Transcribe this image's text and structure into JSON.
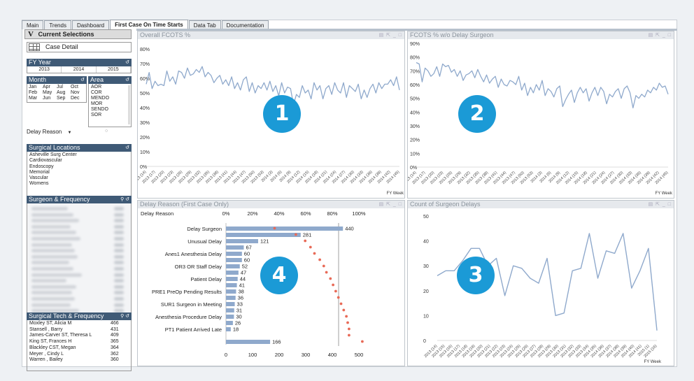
{
  "tabs": [
    {
      "label": "Main",
      "active": false
    },
    {
      "label": "Trends",
      "active": false
    },
    {
      "label": "Dashboard",
      "active": false
    },
    {
      "label": "First Case On Time Starts",
      "active": true
    },
    {
      "label": "Data Tab",
      "active": false
    },
    {
      "label": "Documentation",
      "active": false
    }
  ],
  "left": {
    "current_selections": "Current Selections",
    "current_selections_icon": "V",
    "case_detail": "Case Detail",
    "fy_title": "FY Year",
    "fy_years": [
      "2013",
      "2014",
      "2015"
    ],
    "month_title": "Month",
    "months": [
      "Jan",
      "Apr",
      "Jul",
      "Oct",
      "Feb",
      "May",
      "Aug",
      "Nov",
      "Mar",
      "Jun",
      "Sep",
      "Dec"
    ],
    "area_title": "Area",
    "areas": [
      "AOR",
      "COR",
      "MENDO",
      "MOR",
      "SENDO",
      "SOR"
    ],
    "delay_reason_label": "Delay Reason",
    "surgical_locations_title": "Surgical Locations",
    "surgical_locations": [
      "Asheville Surg Center",
      "Cardiovascular",
      "Endoscopy",
      "Memorial",
      "Vascular",
      "Womens"
    ],
    "surgeon_freq_title": "Surgeon & Frequency",
    "tech_freq_title": "Surgical Tech & Frequency",
    "tech_freq": [
      {
        "name": "Moxley ST, Alicia M",
        "value": "466"
      },
      {
        "name": "Stansell , Barry",
        "value": "431"
      },
      {
        "name": "James-Carver ST, Theresa L",
        "value": "409"
      },
      {
        "name": "King ST, Frances H",
        "value": "365"
      },
      {
        "name": "Blackley CST, Megan",
        "value": "364"
      },
      {
        "name": "Meyer , Cindy L",
        "value": "362"
      },
      {
        "name": "Warren , Bailey",
        "value": "360"
      }
    ]
  },
  "panels": {
    "p1_title": "Overall FCOTS %",
    "p2_title": "FCOTS % w/o Delay Surgeon",
    "p3_title": "Count of Surgeon Delays",
    "p4_title": "Delay Reason (First Case Only)",
    "p4_axis_label": "Delay Reason",
    "fy_week": "FY Week",
    "badges": [
      "1",
      "2",
      "3",
      "4"
    ]
  },
  "chart_data": [
    {
      "type": "line",
      "title": "Overall FCOTS %",
      "xlabel": "FY Week",
      "ylabel": "",
      "ylim": [
        0,
        80
      ],
      "yticks": [
        "0%",
        "10%",
        "20%",
        "30%",
        "40%",
        "50%",
        "60%",
        "70%",
        "80%"
      ],
      "xticks": [
        "2013 (14)",
        "2013 (17)",
        "2013 (20)",
        "2013 (23)",
        "2013 (26)",
        "2013 (29)",
        "2013 (32)",
        "2013 (35)",
        "2013 (38)",
        "2013 (41)",
        "2013 (44)",
        "2013 (47)",
        "2013 (50)",
        "2013 (53)",
        "2014 (3)",
        "2014 (6)",
        "2014 (9)",
        "2014 (12)",
        "2014 (15)",
        "2014 (18)",
        "2014 (21)",
        "2014 (24)",
        "2014 (27)",
        "2014 (30)",
        "2014 (33)",
        "2014 (36)",
        "2014 (39)",
        "2014 (42)",
        "2014 (45)"
      ],
      "series": [
        {
          "values": [
            56,
            64,
            53,
            58,
            55,
            56,
            55,
            65,
            58,
            61,
            56,
            65,
            64,
            60,
            67,
            62,
            63,
            66,
            64,
            68,
            61,
            64,
            62,
            57,
            60,
            62,
            56,
            59,
            55,
            61,
            53,
            57,
            52,
            59,
            61,
            51,
            57,
            50,
            55,
            53,
            57,
            52,
            58,
            51,
            55,
            48,
            57,
            50,
            54,
            53,
            42,
            49,
            47,
            55,
            50,
            52,
            46,
            57,
            52,
            55,
            46,
            53,
            55,
            49,
            57,
            52,
            50,
            57,
            47,
            55,
            53,
            51,
            56,
            46,
            52,
            47,
            53,
            56,
            50,
            57,
            53,
            56,
            56,
            59,
            55,
            61,
            52
          ]
        }
      ]
    },
    {
      "type": "line",
      "title": "FCOTS % w/o Delay Surgeon",
      "xlabel": "FY Week",
      "ylabel": "",
      "ylim": [
        0,
        90
      ],
      "yticks": [
        "0%",
        "10%",
        "20%",
        "30%",
        "40%",
        "50%",
        "60%",
        "70%",
        "80%",
        "90%"
      ],
      "xticks": [
        "2013 (14)",
        "2013 (17)",
        "2013 (20)",
        "2013 (23)",
        "2013 (26)",
        "2013 (29)",
        "2013 (32)",
        "2013 (35)",
        "2013 (38)",
        "2013 (41)",
        "2013 (44)",
        "2013 (47)",
        "2013 (50)",
        "2013 (53)",
        "2014 (3)",
        "2014 (6)",
        "2014 (9)",
        "2014 (12)",
        "2014 (15)",
        "2014 (18)",
        "2014 (21)",
        "2014 (24)",
        "2014 (27)",
        "2014 (30)",
        "2014 (33)",
        "2014 (36)",
        "2014 (39)",
        "2014 (42)",
        "2014 (45)"
      ],
      "series": [
        {
          "values": [
            76,
            75,
            62,
            72,
            70,
            66,
            68,
            73,
            66,
            75,
            73,
            74,
            69,
            71,
            66,
            70,
            63,
            67,
            68,
            70,
            65,
            71,
            66,
            62,
            67,
            61,
            64,
            66,
            58,
            64,
            60,
            59,
            63,
            62,
            60,
            66,
            56,
            61,
            52,
            58,
            54,
            60,
            56,
            63,
            52,
            57,
            55,
            51,
            57,
            59,
            44,
            49,
            53,
            56,
            47,
            54,
            58,
            54,
            57,
            48,
            54,
            58,
            52,
            58,
            55,
            46,
            53,
            51,
            55,
            57,
            50,
            57,
            59,
            54,
            43,
            52,
            50,
            53,
            51,
            56,
            54,
            58,
            56,
            61,
            58,
            59,
            53
          ]
        }
      ]
    },
    {
      "type": "line",
      "title": "Count of Surgeon Delays",
      "xlabel": "FY Week",
      "ylabel": "",
      "ylim": [
        0,
        50
      ],
      "yticks": [
        "0",
        "10",
        "20",
        "30",
        "40",
        "50"
      ],
      "xticks": [
        "2013 (14)",
        "2013 (15)",
        "2013 (16)",
        "2013 (17)",
        "2013 (18)",
        "2013 (19)",
        "2013 (20)",
        "2013 (21)",
        "2013 (22)",
        "2013 (23)",
        "2013 (24)",
        "2013 (25)",
        "2013 (26)",
        "2013 (27)",
        "2013 (28)",
        "2013 (29)",
        "2013 (30)",
        "2013 (31)",
        "2013 (32)",
        "2013 (33)",
        "2013 (34)",
        "2014 (35)",
        "2014 (36)",
        "2014 (37)",
        "2014 (38)",
        "2014 (39)",
        "2014 (40)",
        "2014 (41)",
        "2015 (1)",
        "2015 (16)"
      ],
      "series": [
        {
          "values": [
            26,
            28,
            28,
            32,
            37,
            37,
            30,
            33,
            18,
            30,
            29,
            25,
            23,
            33,
            10,
            11,
            28,
            29,
            43,
            25,
            36,
            35,
            43,
            21,
            28,
            37,
            4
          ]
        }
      ]
    },
    {
      "type": "bar",
      "orientation": "horizontal",
      "title": "Delay Reason (First Case Only)",
      "xlabel": "",
      "ylabel": "Delay Reason",
      "xlim": [
        0,
        500
      ],
      "xticks": [
        "0",
        "100",
        "200",
        "300",
        "400",
        "500"
      ],
      "top_ticks": [
        "0%",
        "20%",
        "40%",
        "60%",
        "80%",
        "100%"
      ],
      "categories": [
        "Delay Surgeon",
        "",
        "Unusual Delay",
        "",
        "Anes1 Anesthesia Delay",
        "",
        "OR3 OR Staff Delay",
        "",
        "Patient Delay",
        "",
        "PRE1 PreOp Pending Results",
        "",
        "SUR1 Surgeon in Meeting",
        "",
        "Anesthesia Procedure Delay",
        "",
        "PT1 Patient Arrived Late",
        "",
        ""
      ],
      "values": [
        440,
        281,
        121,
        67,
        60,
        60,
        52,
        47,
        44,
        41,
        38,
        36,
        33,
        31,
        30,
        26,
        18,
        0,
        166
      ],
      "cumulative_pct": [
        25,
        41,
        48,
        52,
        55,
        59,
        62,
        64,
        67,
        69,
        71,
        73,
        75,
        77,
        79,
        80,
        81,
        81,
        91
      ]
    }
  ]
}
